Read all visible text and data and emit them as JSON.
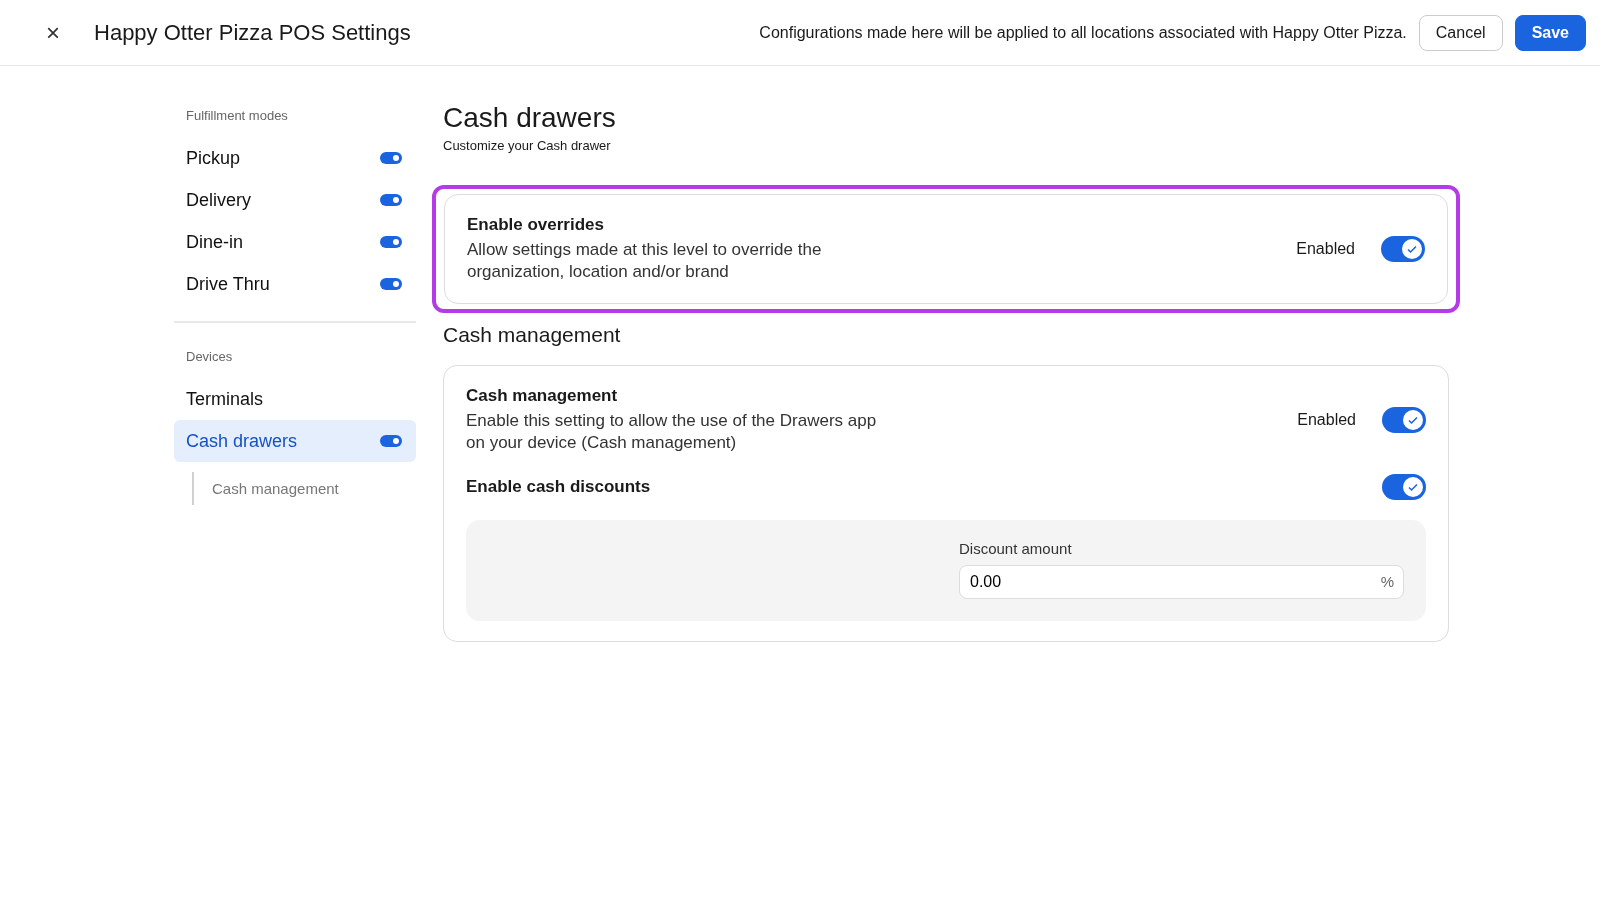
{
  "header": {
    "close": "×",
    "title": "Happy Otter Pizza POS Settings",
    "notice": "Configurations made here will be applied to all locations associated with Happy Otter Pizza.",
    "buttons": [
      {
        "label": "Cancel",
        "kind": "secondary"
      },
      {
        "label": "Save",
        "kind": "primary"
      }
    ]
  },
  "sidebar": {
    "sections": [
      {
        "heading": "Fulfillment modes",
        "items": [
          {
            "label": "Pickup",
            "kind": "toggle",
            "on": true,
            "selected": false
          },
          {
            "label": "Delivery",
            "kind": "toggle",
            "on": true,
            "selected": false
          },
          {
            "label": "Dine-in",
            "kind": "toggle",
            "on": true,
            "selected": false
          },
          {
            "label": "Drive Thru",
            "kind": "toggle",
            "on": true,
            "selected": false
          }
        ]
      },
      {
        "heading": "Devices",
        "items": [
          {
            "label": "Terminals",
            "kind": "plain",
            "selected": false
          },
          {
            "label": "Cash drawers",
            "kind": "toggle",
            "on": true,
            "selected": true,
            "children": [
              {
                "label": "Cash management"
              }
            ]
          }
        ]
      }
    ]
  },
  "page": {
    "title": "Cash drawers",
    "subtitle": "Customize your Cash drawer",
    "overrides": {
      "highlighted": true,
      "title": "Enable overrides",
      "description": "Allow settings made at this level to override the organization, location and/or brand",
      "status": "Enabled",
      "on": true
    },
    "section_title": "Cash management",
    "settings": [
      {
        "title": "Cash management",
        "description": "Enable this setting to allow the use of the Drawers app on your device (Cash management)",
        "status": "Enabled",
        "on": true
      },
      {
        "title": "Enable cash discounts",
        "on": true
      }
    ],
    "discount": {
      "label": "Discount amount",
      "value": "0.00",
      "unit": "%"
    }
  }
}
